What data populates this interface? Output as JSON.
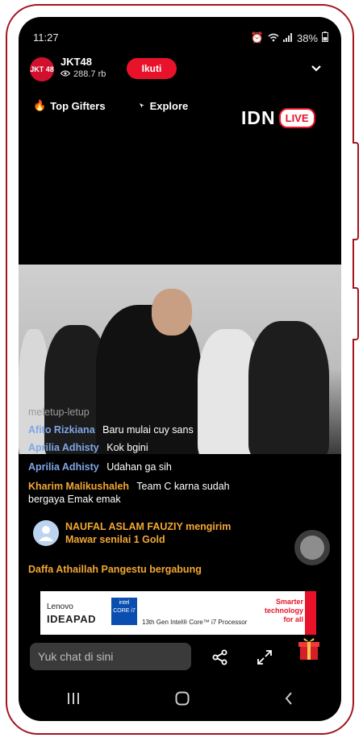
{
  "status": {
    "time": "11:27",
    "battery": "38%"
  },
  "header": {
    "avatar_text": "JKT 48",
    "channel_name": "JKT48",
    "viewers": "288.7 rb",
    "follow_label": "Ikuti"
  },
  "tabs": {
    "top_gifters": "Top Gifters",
    "explore": "Explore"
  },
  "logo": {
    "idn": "IDN",
    "live": "LIVE"
  },
  "chat": {
    "faded": "meletup-letup",
    "messages": [
      {
        "user": "Afito Rizkiana",
        "text": "Baru mulai cuy sans"
      },
      {
        "user": "Aprilia Adhisty",
        "text": "Kok bgini"
      },
      {
        "user": "Aprilia Adhisty",
        "text": "Udahan ga sih"
      },
      {
        "user": "Kharim Malikushaleh",
        "text": "Team C karna sudah bergaya Emak emak"
      }
    ],
    "gift_notice": "NAUFAL ASLAM FAUZIY mengirim Mawar senilai 1 Gold",
    "join_notice": "Daffa Athaillah Pangestu bergabung"
  },
  "ad": {
    "brand": "Lenovo",
    "product": "IDEAPAD",
    "intel_badge": "intel CORE i7",
    "processor": "13th Gen Intel® Core™ i7 Processor",
    "slogan": "Smarter technology for all"
  },
  "input": {
    "placeholder": "Yuk chat di sini"
  },
  "colors": {
    "accent": "#e8132a",
    "frame": "#a3141e",
    "chat_user": "#7fa6e6",
    "gift": "#f3a733"
  }
}
